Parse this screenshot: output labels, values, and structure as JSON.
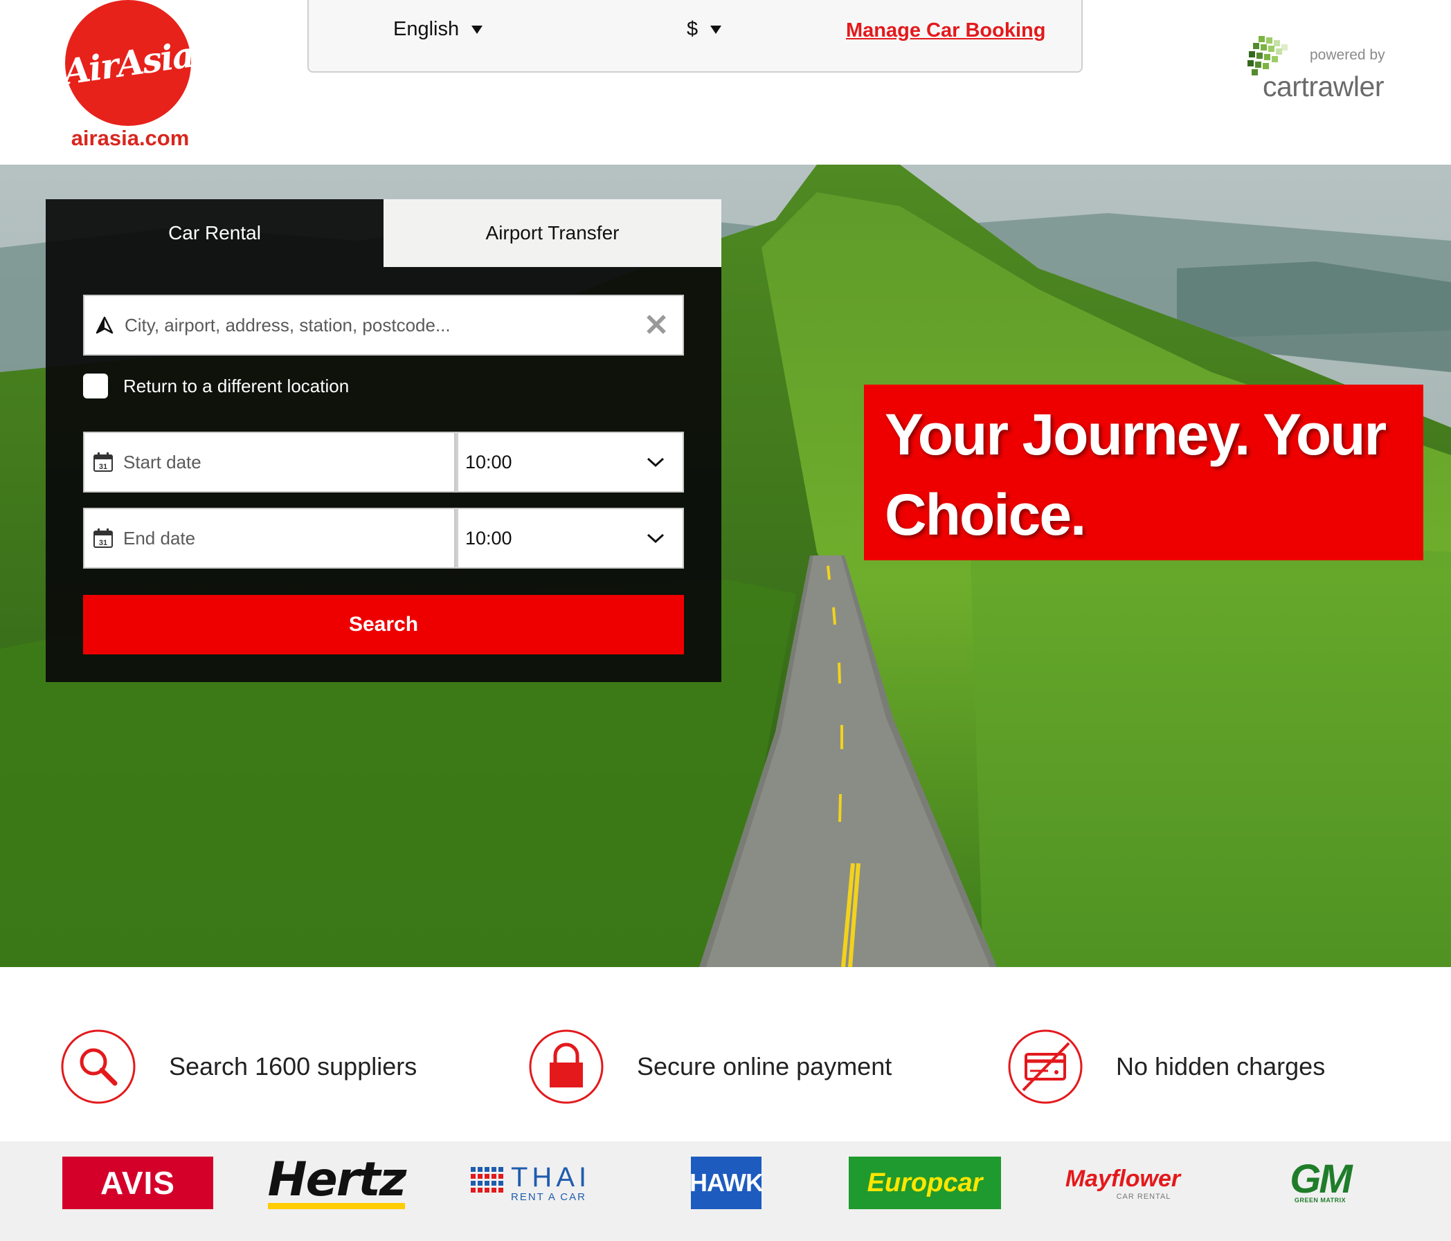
{
  "header": {
    "logo_script": "AirAsia",
    "logo_domain": "airasia.com",
    "language": "English",
    "currency": "$",
    "manage_booking": "Manage Car Booking",
    "powered_by": "powered by",
    "partner": "cartrawler"
  },
  "search_panel": {
    "tabs": [
      {
        "label": "Car Rental",
        "active": true
      },
      {
        "label": "Airport Transfer",
        "active": false
      }
    ],
    "location_placeholder": "City, airport, address, station, postcode...",
    "return_label": "Return to a different location",
    "return_checked": false,
    "start_date_placeholder": "Start date",
    "end_date_placeholder": "End date",
    "start_time": "10:00",
    "end_time": "10:00",
    "calendar_day": "31",
    "search_label": "Search"
  },
  "banner": {
    "headline": "Your Journey. Your Choice."
  },
  "features": [
    {
      "icon": "search-icon",
      "text": "Search 1600 suppliers"
    },
    {
      "icon": "lock-icon",
      "text": "Secure online payment"
    },
    {
      "icon": "no-card-icon",
      "text": "No hidden charges"
    }
  ],
  "suppliers": {
    "avis": "AVIS",
    "hertz": "Hertz",
    "thai_big": "THAI",
    "thai_small": "RENT A CAR",
    "hawk": "HAWK",
    "europcar": "Europcar",
    "mayflower": "Mayflower",
    "mayflower_sub": "CAR RENTAL",
    "gm": "GM",
    "gm_sub": "GREEN MATRIX"
  },
  "colors": {
    "brand_red": "#ee0000",
    "airasia_red": "#e6221b",
    "link_red": "#e3191c"
  }
}
